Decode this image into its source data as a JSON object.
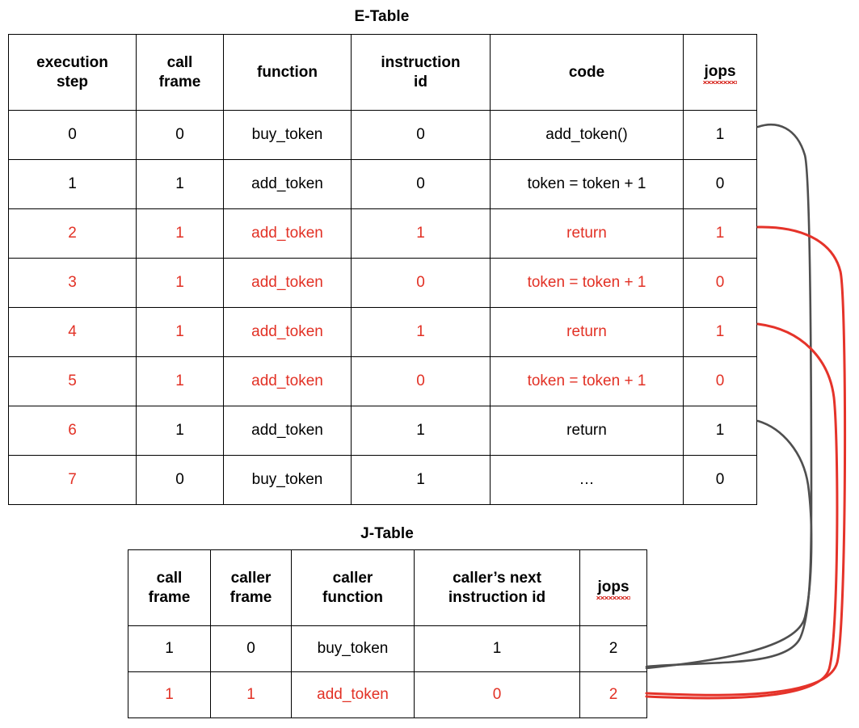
{
  "etable": {
    "title": "E-Table",
    "columns": [
      {
        "id": "execution-step",
        "label": "execution\nstep"
      },
      {
        "id": "call-frame",
        "label": "call\nframe"
      },
      {
        "id": "function",
        "label": "function"
      },
      {
        "id": "instruction-id",
        "label": "instruction\nid"
      },
      {
        "id": "code",
        "label": "code"
      },
      {
        "id": "jops",
        "label": "jops",
        "spellcheck_error": true
      }
    ],
    "rows": [
      {
        "execution_step": "0",
        "call_frame": "0",
        "function": "buy_token",
        "instruction_id": "0",
        "code": "add_token()",
        "jops": "1",
        "colors": {
          "execution_step": "black",
          "call_frame": "black",
          "function": "black",
          "instruction_id": "black",
          "code": "black",
          "jops": "black"
        }
      },
      {
        "execution_step": "1",
        "call_frame": "1",
        "function": "add_token",
        "instruction_id": "0",
        "code": "token = token + 1",
        "jops": "0",
        "colors": {
          "execution_step": "black",
          "call_frame": "black",
          "function": "black",
          "instruction_id": "black",
          "code": "black",
          "jops": "black"
        }
      },
      {
        "execution_step": "2",
        "call_frame": "1",
        "function": "add_token",
        "instruction_id": "1",
        "code": "return",
        "jops": "1",
        "colors": {
          "execution_step": "red",
          "call_frame": "red",
          "function": "red",
          "instruction_id": "red",
          "code": "red",
          "jops": "red"
        }
      },
      {
        "execution_step": "3",
        "call_frame": "1",
        "function": "add_token",
        "instruction_id": "0",
        "code": "token = token + 1",
        "jops": "0",
        "colors": {
          "execution_step": "red",
          "call_frame": "red",
          "function": "red",
          "instruction_id": "red",
          "code": "red",
          "jops": "red"
        }
      },
      {
        "execution_step": "4",
        "call_frame": "1",
        "function": "add_token",
        "instruction_id": "1",
        "code": "return",
        "jops": "1",
        "colors": {
          "execution_step": "red",
          "call_frame": "red",
          "function": "red",
          "instruction_id": "red",
          "code": "red",
          "jops": "red"
        }
      },
      {
        "execution_step": "5",
        "call_frame": "1",
        "function": "add_token",
        "instruction_id": "0",
        "code": "token = token + 1",
        "jops": "0",
        "colors": {
          "execution_step": "red",
          "call_frame": "red",
          "function": "red",
          "instruction_id": "red",
          "code": "red",
          "jops": "red"
        }
      },
      {
        "execution_step": "6",
        "call_frame": "1",
        "function": "add_token",
        "instruction_id": "1",
        "code": "return",
        "jops": "1",
        "colors": {
          "execution_step": "red",
          "call_frame": "black",
          "function": "black",
          "instruction_id": "black",
          "code": "black",
          "jops": "black"
        }
      },
      {
        "execution_step": "7",
        "call_frame": "0",
        "function": "buy_token",
        "instruction_id": "1",
        "code": "…",
        "jops": "0",
        "colors": {
          "execution_step": "red",
          "call_frame": "black",
          "function": "black",
          "instruction_id": "black",
          "code": "black",
          "jops": "black"
        }
      }
    ]
  },
  "jtable": {
    "title": "J-Table",
    "columns": [
      {
        "id": "call-frame",
        "label": "call\nframe"
      },
      {
        "id": "caller-frame",
        "label": "caller\nframe"
      },
      {
        "id": "caller-function",
        "label": "caller\nfunction"
      },
      {
        "id": "callers-next-instruction-id",
        "label": "caller’s next\ninstruction id"
      },
      {
        "id": "jops",
        "label": "jops",
        "spellcheck_error": true
      }
    ],
    "rows": [
      {
        "call_frame": "1",
        "caller_frame": "0",
        "caller_function": "buy_token",
        "callers_next_instruction_id": "1",
        "jops": "2",
        "color": "black"
      },
      {
        "call_frame": "1",
        "caller_frame": "1",
        "caller_function": "add_token",
        "callers_next_instruction_id": "0",
        "jops": "2",
        "color": "red"
      }
    ]
  },
  "connectors": {
    "gray_color": "#4f4f4f",
    "red_color": "#e5332a",
    "links": [
      {
        "id": "gray-link-step-0",
        "color": "gray",
        "from": "etable row 0 jops",
        "to": "jtable row 1 jops"
      },
      {
        "id": "gray-link-step-6",
        "color": "gray",
        "from": "etable row 6 jops",
        "to": "jtable row 1 jops"
      },
      {
        "id": "red-link-step-2",
        "color": "red",
        "from": "etable row 2 jops",
        "to": "jtable row 2 jops"
      },
      {
        "id": "red-link-step-4",
        "color": "red",
        "from": "etable row 4 jops",
        "to": "jtable row 2 jops"
      }
    ]
  },
  "colors": {
    "text": "#000000",
    "accent_red": "#e23125",
    "connector_gray": "#4f4f4f",
    "spellcheck_underline": "#d6231b",
    "background": "#ffffff",
    "border": "#000000"
  }
}
